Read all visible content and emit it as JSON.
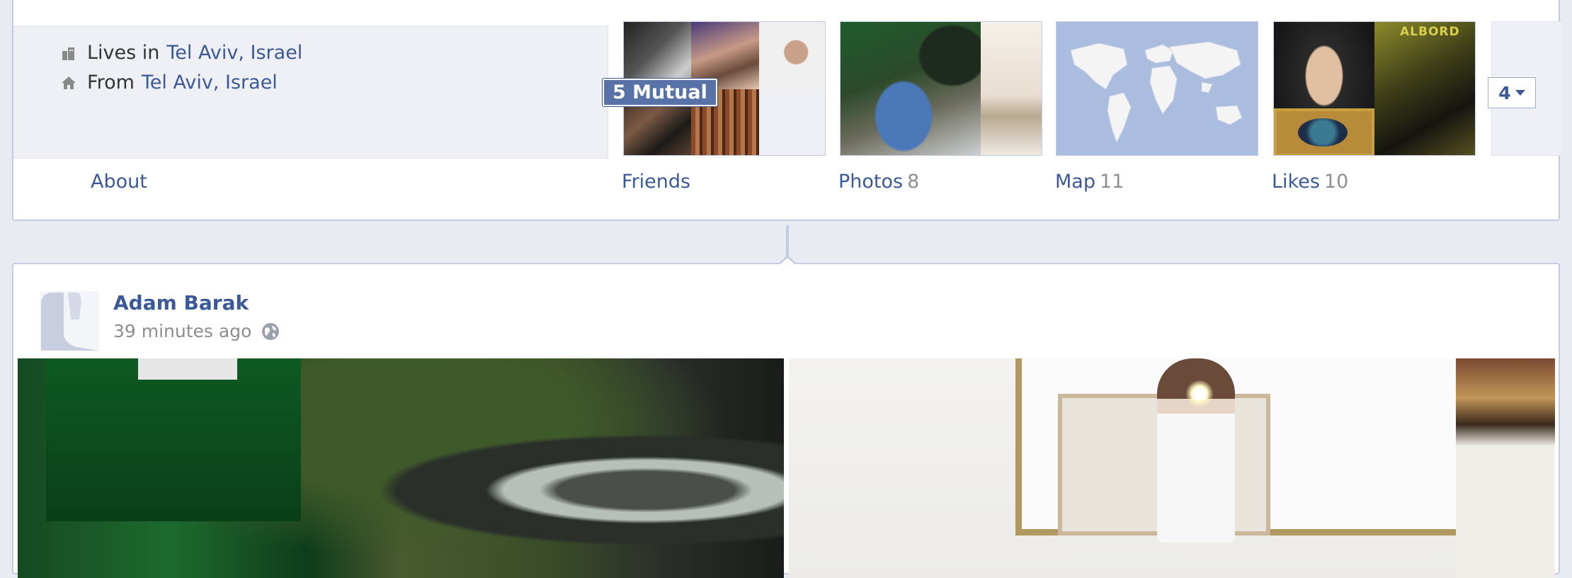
{
  "about": {
    "lives_label": "Lives in",
    "lives_place": "Tel Aviv, Israel",
    "from_label": "From",
    "from_place": "Tel Aviv, Israel",
    "tab_label": "About"
  },
  "tiles": {
    "friends": {
      "label": "Friends",
      "mutual_badge": "5 Mutual"
    },
    "photos": {
      "label": "Photos",
      "count": "8"
    },
    "map": {
      "label": "Map",
      "count": "11"
    },
    "likes": {
      "label": "Likes",
      "count": "10",
      "album_text": "ALBORD"
    },
    "more": {
      "count": "4"
    }
  },
  "post": {
    "author": "Adam Barak",
    "timestamp": "39 minutes ago",
    "privacy_icon": "globe-icon"
  },
  "colors": {
    "link": "#3b5998",
    "muted": "#8e8e8e",
    "page_bg": "#e9ebf2",
    "border": "#c4cde0"
  }
}
